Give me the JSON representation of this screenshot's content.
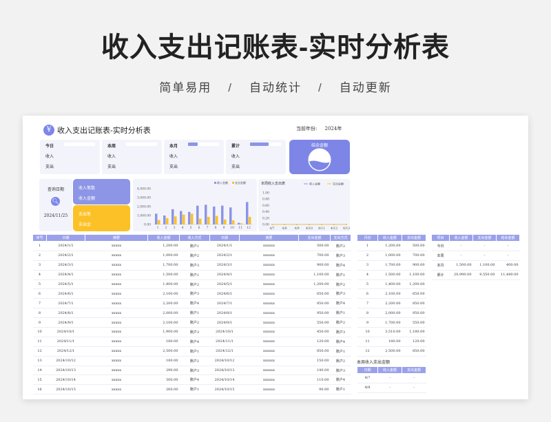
{
  "hero": {
    "title": "收入支出记账表-实时分析表",
    "tags": [
      "简单易用",
      "自动统计",
      "自动更新"
    ],
    "separator": "/"
  },
  "sheet": {
    "logo_glyph": "¥",
    "title": "收入支出记账表-实时分析表",
    "year_label": "当前年份:",
    "year_value": "2024年"
  },
  "summary_cards": [
    {
      "title": "今日",
      "rows": [
        "收入",
        "支出"
      ],
      "fill": 0
    },
    {
      "title": "本周",
      "rows": [
        "收入",
        "支出"
      ],
      "fill": 0
    },
    {
      "title": "本月",
      "rows": [
        "收入",
        "支出"
      ],
      "fill": 0.3
    },
    {
      "title": "累计",
      "rows": [
        "收入",
        "支出"
      ],
      "fill": 0.6
    }
  ],
  "balance": {
    "label": "结余金额",
    "fill": 0.4,
    "color": "#7d86e6"
  },
  "query": {
    "label": "查询日期",
    "icon": "search-icon",
    "date": "2024/11/25"
  },
  "income_box": {
    "label": "收入笔数",
    "amount_label": "收入金额",
    "color": "#8c95e6"
  },
  "expense_box": {
    "label": "支出笔",
    "amount_label": "支出金",
    "color": "#fcc126"
  },
  "chart_data": [
    {
      "type": "bar",
      "title": "",
      "categories": [
        "1",
        "2",
        "3",
        "4",
        "5",
        "6",
        "7",
        "8",
        "9",
        "10",
        "11",
        "12"
      ],
      "series": [
        {
          "name": "收入金额",
          "color": "#8c95e3",
          "values": [
            1200,
            1000,
            1700,
            1500,
            1400,
            2100,
            2200,
            2000,
            2100,
            1900,
            180,
            2500
          ]
        },
        {
          "name": "支出金额",
          "color": "#fcc126",
          "values": [
            500,
            700,
            900,
            1100,
            1200,
            650,
            850,
            950,
            550,
            450,
            120,
            850
          ]
        }
      ],
      "yticks": [
        "4,000.00",
        "3,000.00",
        "2,000.00",
        "1,000.00",
        "0.00"
      ],
      "ylim": [
        0,
        4000
      ]
    },
    {
      "type": "line",
      "title": "本周收入支出表",
      "categories": [
        "4/7",
        "4/8",
        "4/9",
        "4/10",
        "4/11",
        "4/12",
        "4/13"
      ],
      "series": [
        {
          "name": "收入金额",
          "color": "#8c95e3",
          "values": [
            0,
            0,
            0,
            0,
            0,
            0,
            0
          ]
        },
        {
          "name": "支出金额",
          "color": "#fcc126",
          "values": [
            0,
            0,
            0,
            0,
            0,
            0,
            0
          ]
        }
      ],
      "yticks": [
        "1.00",
        "0.80",
        "0.60",
        "0.40",
        "0.20",
        "0.00"
      ],
      "ylim": [
        0,
        1
      ]
    }
  ],
  "main_table": {
    "headers": [
      "序号",
      "日期",
      "摘要",
      "收入金额",
      "收入方式",
      "日期",
      "摘要",
      "支出金额",
      "支出方式"
    ],
    "rows": [
      [
        "1",
        "2024/1/1",
        "xxxxx",
        "1,200.00",
        "账户1",
        "2024/1/1",
        "xxxxxx",
        "500.00",
        "账户2"
      ],
      [
        "2",
        "2024/2/1",
        "xxxxx",
        "1,000.00",
        "账户2",
        "2024/2/1",
        "xxxxxx",
        "700.00",
        "账户3"
      ],
      [
        "3",
        "2024/3/1",
        "xxxxx",
        "1,700.00",
        "账户3",
        "2024/3/1",
        "xxxxxx",
        "900.00",
        "账户4"
      ],
      [
        "4",
        "2024/4/1",
        "xxxxx",
        "1,500.00",
        "账户1",
        "2024/4/1",
        "xxxxxx",
        "1,100.00",
        "账户1"
      ],
      [
        "5",
        "2024/5/1",
        "xxxxx",
        "1,400.00",
        "账户2",
        "2024/5/1",
        "xxxxxx",
        "1,200.00",
        "账户2"
      ],
      [
        "6",
        "2024/6/1",
        "xxxxx",
        "2,100.00",
        "账户3",
        "2024/6/1",
        "xxxxxx",
        "650.00",
        "账户3"
      ],
      [
        "7",
        "2024/7/1",
        "xxxxx",
        "2,200.00",
        "账户4",
        "2024/7/1",
        "xxxxxx",
        "850.00",
        "账户4"
      ],
      [
        "8",
        "2024/8/1",
        "xxxxx",
        "2,000.00",
        "账户1",
        "2024/8/1",
        "xxxxxx",
        "950.00",
        "账户1"
      ],
      [
        "9",
        "2024/9/1",
        "xxxxx",
        "2,100.00",
        "账户2",
        "2024/9/1",
        "xxxxxx",
        "550.00",
        "账户2"
      ],
      [
        "10",
        "2024/10/1",
        "xxxxx",
        "1,900.00",
        "账户3",
        "2024/10/1",
        "xxxxxx",
        "450.00",
        "账户3"
      ],
      [
        "11",
        "2024/11/1",
        "xxxxx",
        "180.00",
        "账户4",
        "2024/11/1",
        "xxxxxx",
        "120.00",
        "账户4"
      ],
      [
        "12",
        "2024/12/1",
        "xxxxx",
        "2,500.00",
        "账户1",
        "2024/12/1",
        "xxxxxx",
        "850.00",
        "账户1"
      ],
      [
        "13",
        "2024/10/12",
        "xxxxx",
        "180.00",
        "账户2",
        "2024/10/12",
        "xxxxxx",
        "150.00",
        "账户2"
      ],
      [
        "14",
        "2024/10/13",
        "xxxxx",
        "290.00",
        "账户3",
        "2024/10/13",
        "xxxxxx",
        "140.00",
        "账户3"
      ],
      [
        "15",
        "2024/10/14",
        "xxxxx",
        "300.00",
        "账户4",
        "2024/10/14",
        "xxxxxx",
        "110.00",
        "账户4"
      ],
      [
        "16",
        "2024/10/15",
        "xxxxx",
        "260.00",
        "账户1",
        "2024/10/15",
        "xxxxxx",
        "90.00",
        "账户1"
      ]
    ]
  },
  "month_table": {
    "headers": [
      "月份",
      "收入金额",
      "支出金额"
    ],
    "rows": [
      [
        "1",
        "1,200.00",
        "500.00"
      ],
      [
        "2",
        "1,000.00",
        "700.00"
      ],
      [
        "3",
        "1,700.00",
        "900.00"
      ],
      [
        "4",
        "1,500.00",
        "1,100.00"
      ],
      [
        "5",
        "1,400.00",
        "1,200.00"
      ],
      [
        "6",
        "2,100.00",
        "650.00"
      ],
      [
        "7",
        "2,200.00",
        "850.00"
      ],
      [
        "8",
        "2,000.00",
        "950.00"
      ],
      [
        "9",
        "1,700.00",
        "550.00"
      ],
      [
        "10",
        "3,510.00",
        "1,180.00"
      ],
      [
        "11",
        "180.00",
        "120.00"
      ],
      [
        "12",
        "2,500.00",
        "850.00"
      ]
    ]
  },
  "week_table": {
    "title": "本周收入支出金额",
    "headers": [
      "日期",
      "收入金额",
      "支出金额"
    ],
    "rows": [
      [
        "4/7",
        "-",
        "-"
      ],
      [
        "4/8",
        "-",
        "-"
      ]
    ]
  },
  "totals_table": {
    "headers": [
      "项目",
      "收入金额",
      "支出金额",
      "结余金额"
    ],
    "rows": [
      [
        "今日",
        "-",
        "-",
        "-"
      ],
      [
        "本周",
        "-",
        "-",
        "-"
      ],
      [
        "本月",
        "1,500.00",
        "1,100.00",
        "400.00"
      ],
      [
        "累计",
        "20,990.00",
        "9,550.00",
        "11,440.00"
      ]
    ]
  }
}
